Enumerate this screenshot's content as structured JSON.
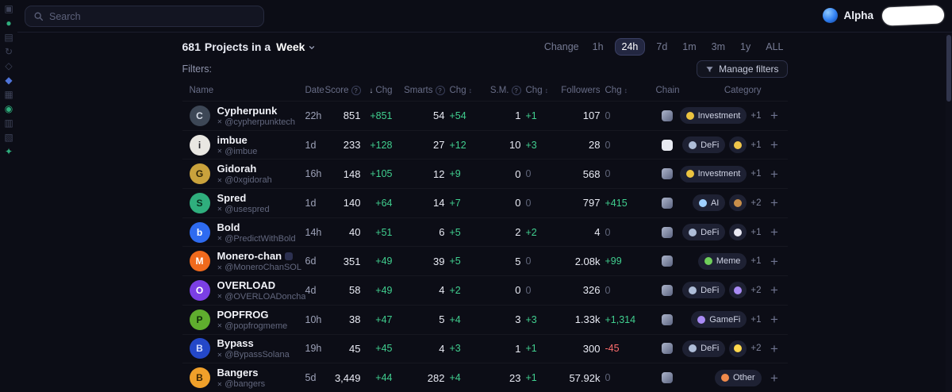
{
  "topbar": {
    "search_placeholder": "Search",
    "alpha_label": "Alpha"
  },
  "rail": {
    "icons": [
      "▣",
      "●",
      "▤",
      "↻",
      "◇",
      "◆",
      "▦",
      "◉",
      "▥",
      "▧",
      "✦"
    ]
  },
  "header": {
    "count": "681",
    "title": "Projects in a",
    "period": "Week",
    "change_label": "Change",
    "ranges": [
      "1h",
      "24h",
      "7d",
      "1m",
      "3m",
      "1y",
      "ALL"
    ],
    "selected_range": "24h"
  },
  "filters": {
    "label": "Filters:",
    "manage_label": "Manage filters"
  },
  "table": {
    "headers": {
      "name": "Name",
      "date": "Date",
      "score": "Score",
      "chg": "Chg",
      "smarts": "Smarts",
      "sm": "S.M.",
      "followers": "Followers",
      "chain": "Chain",
      "category": "Category"
    },
    "help_glyph": "?",
    "sort_desc_glyph": "↓",
    "sort_glyph": "↕",
    "add_button": "+",
    "rows": [
      {
        "name": "Cypherpunk",
        "handle": "@cypherpunktech",
        "avatar_letter": "C",
        "date": "22h",
        "score": "851",
        "score_chg": "+851",
        "smarts": "54",
        "smarts_chg": "+54",
        "sm": "1",
        "sm_chg": "+1",
        "followers": "107",
        "followers_chg": "0",
        "category_emoji": "💰",
        "category_label": "Investment",
        "category_extra": null,
        "category_more": "+1"
      },
      {
        "name": "imbue",
        "handle": "@imbue",
        "avatar_letter": "i",
        "date": "1d",
        "score": "233",
        "score_chg": "+128",
        "smarts": "27",
        "smarts_chg": "+12",
        "sm": "10",
        "sm_chg": "+3",
        "followers": "28",
        "followers_chg": "0",
        "category_emoji": "🏦",
        "category_label": "DeFi",
        "category_extra": "🪙",
        "category_more": "+1"
      },
      {
        "name": "Gidorah",
        "handle": "@0xgidorah",
        "avatar_letter": "G",
        "date": "16h",
        "score": "148",
        "score_chg": "+105",
        "smarts": "12",
        "smarts_chg": "+9",
        "sm": "0",
        "sm_chg": "0",
        "followers": "568",
        "followers_chg": "0",
        "category_emoji": "💰",
        "category_label": "Investment",
        "category_extra": null,
        "category_more": "+1"
      },
      {
        "name": "Spred",
        "handle": "@usespred",
        "avatar_letter": "S",
        "date": "1d",
        "score": "140",
        "score_chg": "+64",
        "smarts": "14",
        "smarts_chg": "+7",
        "sm": "0",
        "sm_chg": "0",
        "followers": "797",
        "followers_chg": "+415",
        "category_emoji": "🤖",
        "category_label": "AI",
        "category_extra": "🛠️",
        "category_more": "+2"
      },
      {
        "name": "Bold",
        "handle": "@PredictWithBold",
        "avatar_letter": "b",
        "date": "14h",
        "score": "40",
        "score_chg": "+51",
        "smarts": "6",
        "smarts_chg": "+5",
        "sm": "2",
        "sm_chg": "+2",
        "followers": "4",
        "followers_chg": "0",
        "category_emoji": "🏦",
        "category_label": "DeFi",
        "category_extra": "🎲",
        "category_more": "+1"
      },
      {
        "name": "Monero-chan",
        "handle": "@MoneroChanSOL",
        "avatar_letter": "M",
        "date": "6d",
        "score": "351",
        "score_chg": "+49",
        "smarts": "39",
        "smarts_chg": "+5",
        "sm": "5",
        "sm_chg": "0",
        "followers": "2.08k",
        "followers_chg": "+99",
        "category_emoji": "🐸",
        "category_label": "Meme",
        "category_extra": null,
        "category_more": "+1"
      },
      {
        "name": "OVERLOAD",
        "handle": "@OVERLOADonchain",
        "avatar_letter": "O",
        "date": "4d",
        "score": "58",
        "score_chg": "+49",
        "smarts": "4",
        "smarts_chg": "+2",
        "sm": "0",
        "sm_chg": "0",
        "followers": "326",
        "followers_chg": "0",
        "category_emoji": "🏦",
        "category_label": "DeFi",
        "category_extra": "🎮",
        "category_more": "+2"
      },
      {
        "name": "POPFROG",
        "handle": "@popfrogmeme",
        "avatar_letter": "P",
        "date": "10h",
        "score": "38",
        "score_chg": "+47",
        "smarts": "5",
        "smarts_chg": "+4",
        "sm": "3",
        "sm_chg": "+3",
        "followers": "1.33k",
        "followers_chg": "+1,314",
        "category_emoji": "🎮",
        "category_label": "GameFi",
        "category_extra": null,
        "category_more": "+1"
      },
      {
        "name": "Bypass",
        "handle": "@BypassSolana",
        "avatar_letter": "B",
        "date": "19h",
        "score": "45",
        "score_chg": "+45",
        "smarts": "4",
        "smarts_chg": "+3",
        "sm": "1",
        "sm_chg": "+1",
        "followers": "300",
        "followers_chg": "-45",
        "category_emoji": "🏦",
        "category_label": "DeFi",
        "category_extra": "⚡",
        "category_more": "+2"
      },
      {
        "name": "Bangers",
        "handle": "@bangers",
        "avatar_letter": "B",
        "date": "5d",
        "score": "3,449",
        "score_chg": "+44",
        "smarts": "282",
        "smarts_chg": "+4",
        "sm": "23",
        "sm_chg": "+1",
        "followers": "57.92k",
        "followers_chg": "0",
        "category_emoji": "🎪",
        "category_label": "Other",
        "category_extra": null,
        "category_more": null
      }
    ]
  },
  "colors": {
    "positive": "#40cf8f",
    "negative": "#ff6d6d",
    "neutral": "#5f6479",
    "background": "#0c0d16",
    "pill_bg": "#1e2133",
    "selected_range_bg": "#232741"
  }
}
